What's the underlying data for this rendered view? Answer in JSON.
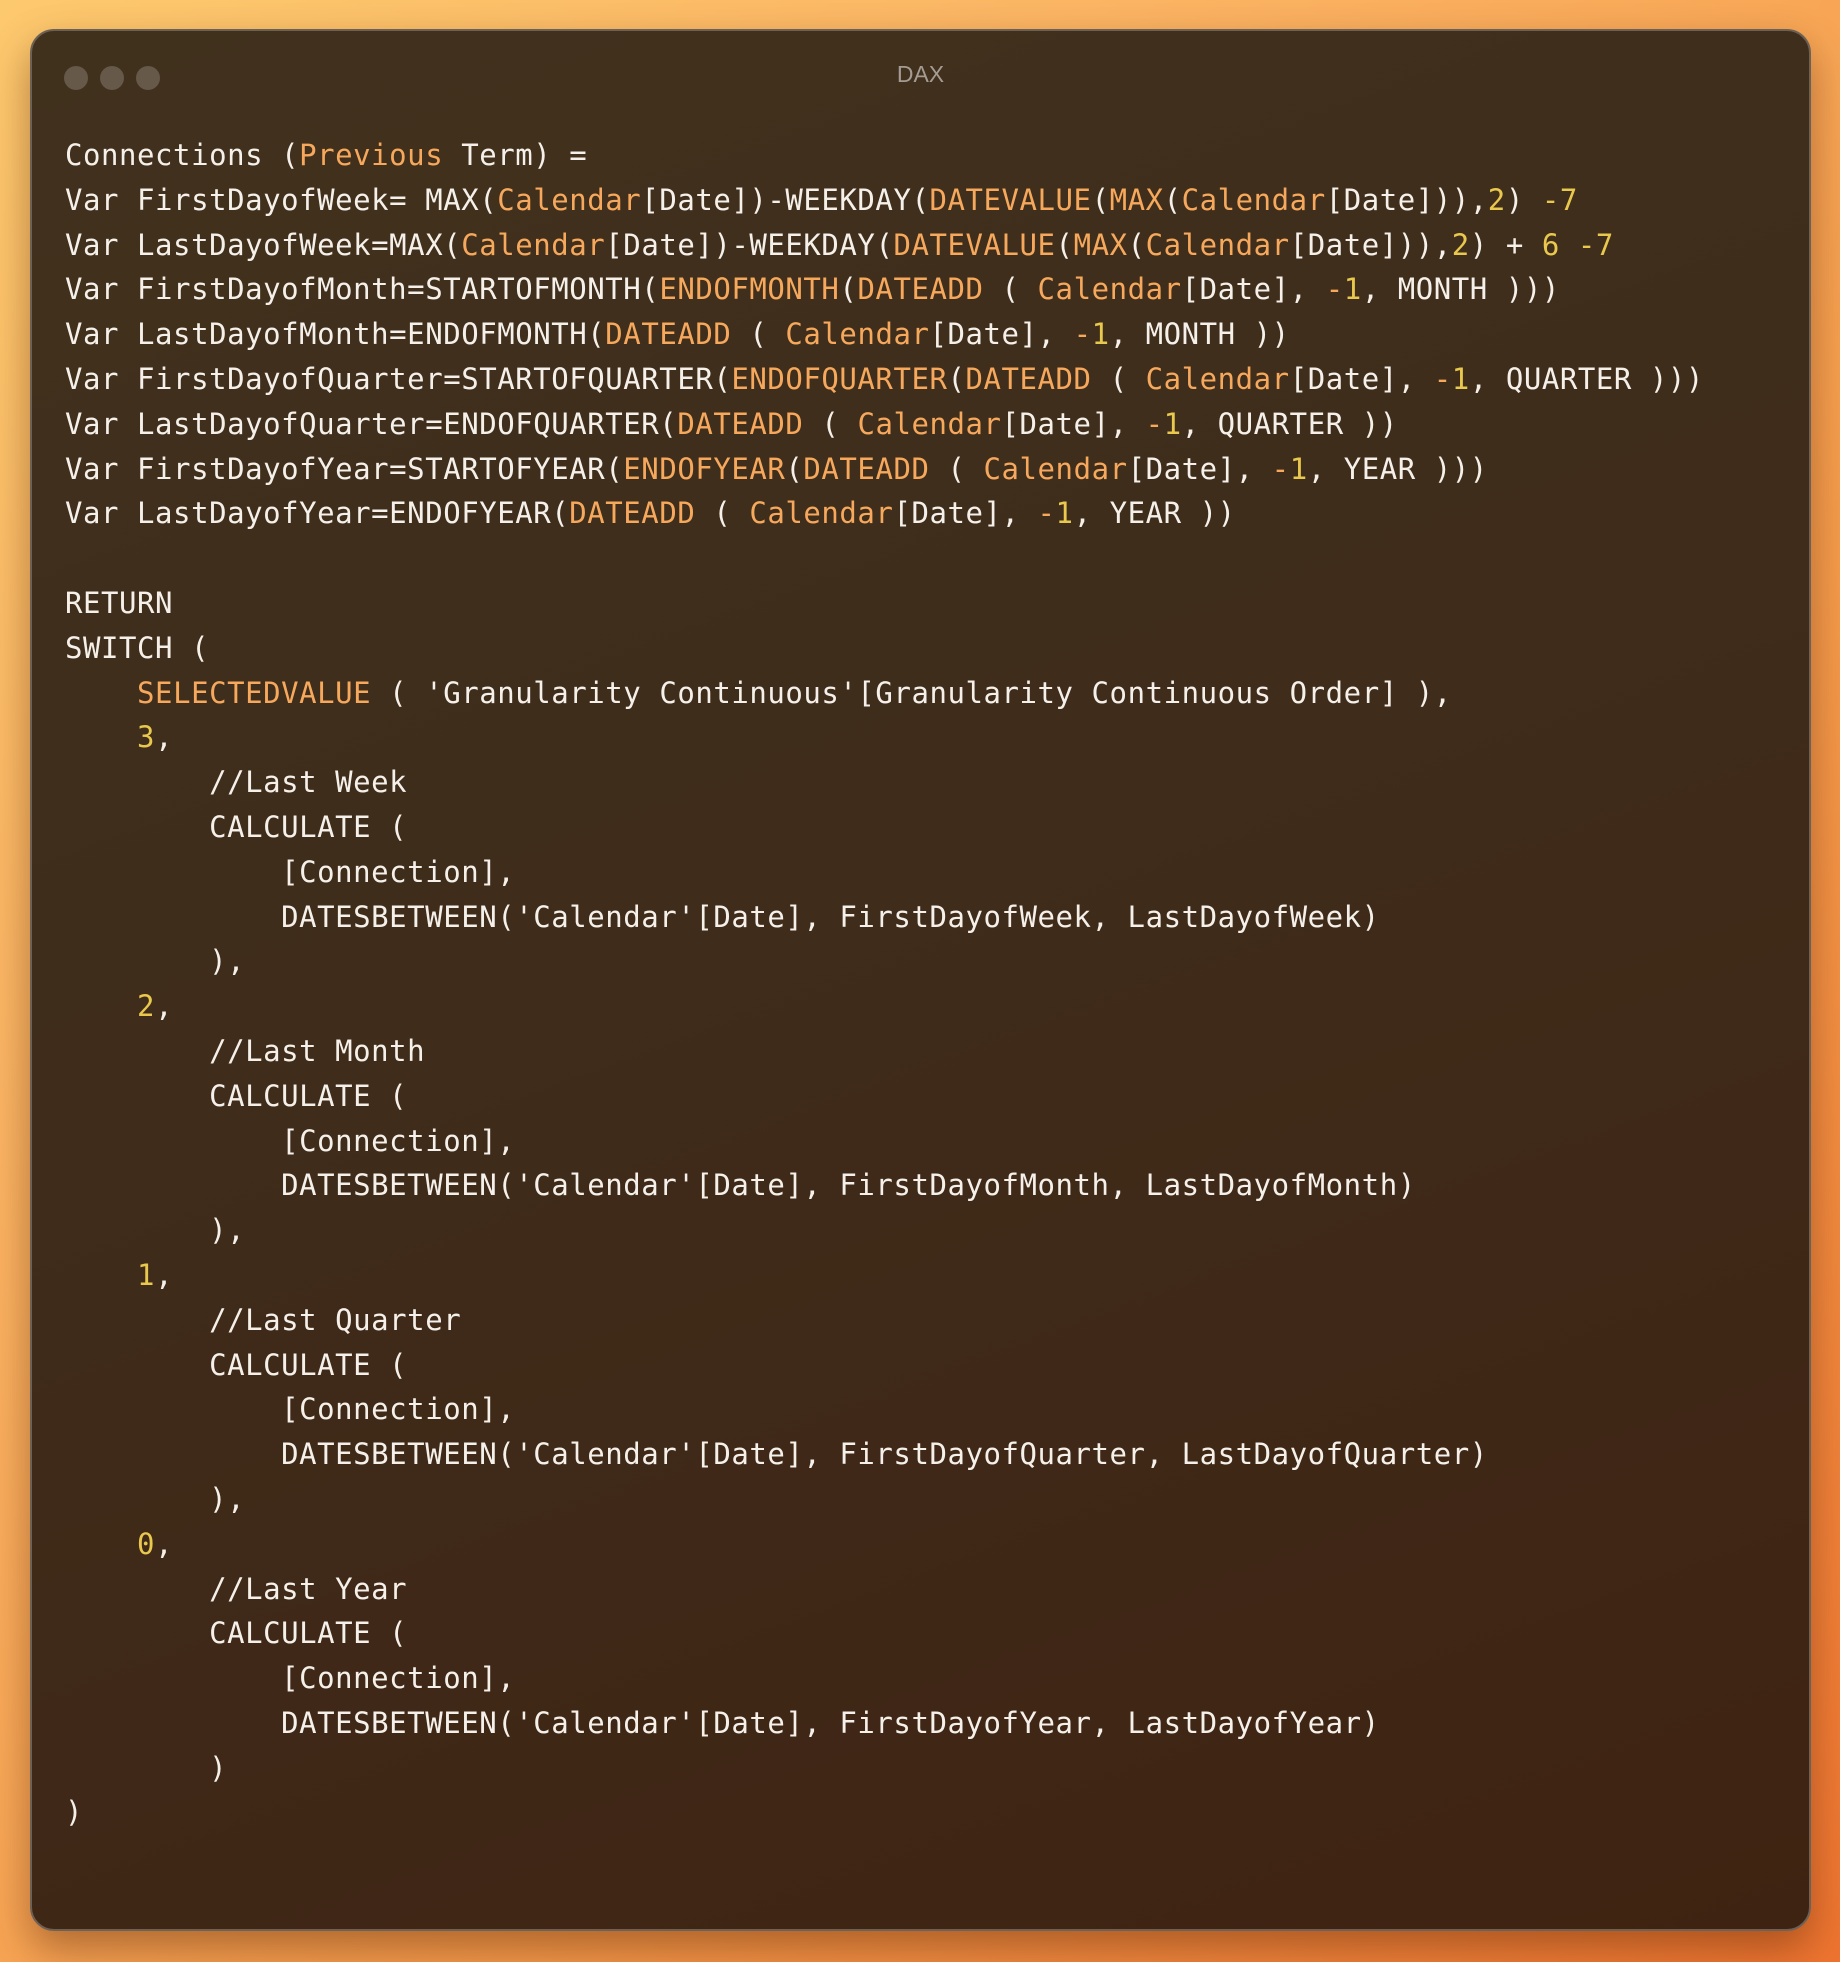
{
  "window": {
    "title": "DAX",
    "traffic_lights": [
      "close-dot",
      "minimize-dot",
      "zoom-dot"
    ]
  },
  "colors": {
    "plain": "#f5f1ea",
    "function": "#f6a85c",
    "number": "#e9c84e",
    "window_bg": "#40301c",
    "title": "#a49c93"
  },
  "code": {
    "language": "DAX",
    "lines": [
      [
        [
          "p",
          "Connections ("
        ],
        [
          "f",
          "Previous"
        ],
        [
          "p",
          " Term) ="
        ]
      ],
      [
        [
          "p",
          "Var FirstDayofWeek= MAX("
        ],
        [
          "f",
          "Calendar"
        ],
        [
          "p",
          "[Date])-WEEKDAY("
        ],
        [
          "f",
          "DATEVALUE"
        ],
        [
          "p",
          "("
        ],
        [
          "f",
          "MAX"
        ],
        [
          "p",
          "("
        ],
        [
          "f",
          "Calendar"
        ],
        [
          "p",
          "[Date])),"
        ],
        [
          "n",
          "2"
        ],
        [
          "p",
          ") "
        ],
        [
          "n",
          "-7"
        ]
      ],
      [
        [
          "p",
          "Var LastDayofWeek=MAX("
        ],
        [
          "f",
          "Calendar"
        ],
        [
          "p",
          "[Date])-WEEKDAY("
        ],
        [
          "f",
          "DATEVALUE"
        ],
        [
          "p",
          "("
        ],
        [
          "f",
          "MAX"
        ],
        [
          "p",
          "("
        ],
        [
          "f",
          "Calendar"
        ],
        [
          "p",
          "[Date])),"
        ],
        [
          "n",
          "2"
        ],
        [
          "p",
          ") + "
        ],
        [
          "n",
          "6"
        ],
        [
          "p",
          " "
        ],
        [
          "n",
          "-7"
        ]
      ],
      [
        [
          "p",
          "Var FirstDayofMonth=STARTOFMONTH("
        ],
        [
          "f",
          "ENDOFMONTH"
        ],
        [
          "p",
          "("
        ],
        [
          "f",
          "DATEADD"
        ],
        [
          "p",
          " ( "
        ],
        [
          "f",
          "Calendar"
        ],
        [
          "p",
          "[Date], "
        ],
        [
          "f",
          "-"
        ],
        [
          "n",
          "1"
        ],
        [
          "p",
          ", MONTH )))"
        ]
      ],
      [
        [
          "p",
          "Var LastDayofMonth=ENDOFMONTH("
        ],
        [
          "f",
          "DATEADD"
        ],
        [
          "p",
          " ( "
        ],
        [
          "f",
          "Calendar"
        ],
        [
          "p",
          "[Date], "
        ],
        [
          "f",
          "-"
        ],
        [
          "n",
          "1"
        ],
        [
          "p",
          ", MONTH ))"
        ]
      ],
      [
        [
          "p",
          "Var FirstDayofQuarter=STARTOFQUARTER("
        ],
        [
          "f",
          "ENDOFQUARTER"
        ],
        [
          "p",
          "("
        ],
        [
          "f",
          "DATEADD"
        ],
        [
          "p",
          " ( "
        ],
        [
          "f",
          "Calendar"
        ],
        [
          "p",
          "[Date], "
        ],
        [
          "f",
          "-"
        ],
        [
          "n",
          "1"
        ],
        [
          "p",
          ", QUARTER )))"
        ]
      ],
      [
        [
          "p",
          "Var LastDayofQuarter=ENDOFQUARTER("
        ],
        [
          "f",
          "DATEADD"
        ],
        [
          "p",
          " ( "
        ],
        [
          "f",
          "Calendar"
        ],
        [
          "p",
          "[Date], "
        ],
        [
          "f",
          "-"
        ],
        [
          "n",
          "1"
        ],
        [
          "p",
          ", QUARTER ))"
        ]
      ],
      [
        [
          "p",
          "Var FirstDayofYear=STARTOFYEAR("
        ],
        [
          "f",
          "ENDOFYEAR"
        ],
        [
          "p",
          "("
        ],
        [
          "f",
          "DATEADD"
        ],
        [
          "p",
          " ( "
        ],
        [
          "f",
          "Calendar"
        ],
        [
          "p",
          "[Date], "
        ],
        [
          "f",
          "-"
        ],
        [
          "n",
          "1"
        ],
        [
          "p",
          ", YEAR )))"
        ]
      ],
      [
        [
          "p",
          "Var LastDayofYear=ENDOFYEAR("
        ],
        [
          "f",
          "DATEADD"
        ],
        [
          "p",
          " ( "
        ],
        [
          "f",
          "Calendar"
        ],
        [
          "p",
          "[Date], "
        ],
        [
          "f",
          "-"
        ],
        [
          "n",
          "1"
        ],
        [
          "p",
          ", YEAR ))"
        ]
      ],
      [],
      [
        [
          "p",
          "RETURN"
        ]
      ],
      [
        [
          "p",
          "SWITCH ("
        ]
      ],
      [
        [
          "p",
          "    "
        ],
        [
          "f",
          "SELECTEDVALUE"
        ],
        [
          "p",
          " ( 'Granularity Continuous'[Granularity Continuous Order] ),"
        ]
      ],
      [
        [
          "p",
          "    "
        ],
        [
          "n",
          "3"
        ],
        [
          "p",
          ","
        ]
      ],
      [
        [
          "p",
          "        //Last Week"
        ]
      ],
      [
        [
          "p",
          "        CALCULATE ("
        ]
      ],
      [
        [
          "p",
          "            [Connection],"
        ]
      ],
      [
        [
          "p",
          "            DATESBETWEEN('Calendar'[Date], FirstDayofWeek, LastDayofWeek)"
        ]
      ],
      [
        [
          "p",
          "        ),"
        ]
      ],
      [
        [
          "p",
          "    "
        ],
        [
          "n",
          "2"
        ],
        [
          "p",
          ","
        ]
      ],
      [
        [
          "p",
          "        //Last Month"
        ]
      ],
      [
        [
          "p",
          "        CALCULATE ("
        ]
      ],
      [
        [
          "p",
          "            [Connection],"
        ]
      ],
      [
        [
          "p",
          "            DATESBETWEEN('Calendar'[Date], FirstDayofMonth, LastDayofMonth)"
        ]
      ],
      [
        [
          "p",
          "        ),"
        ]
      ],
      [
        [
          "p",
          "    "
        ],
        [
          "n",
          "1"
        ],
        [
          "p",
          ","
        ]
      ],
      [
        [
          "p",
          "        //Last Quarter"
        ]
      ],
      [
        [
          "p",
          "        CALCULATE ("
        ]
      ],
      [
        [
          "p",
          "            [Connection],"
        ]
      ],
      [
        [
          "p",
          "            DATESBETWEEN('Calendar'[Date], FirstDayofQuarter, LastDayofQuarter)"
        ]
      ],
      [
        [
          "p",
          "        ),"
        ]
      ],
      [
        [
          "p",
          "    "
        ],
        [
          "n",
          "0"
        ],
        [
          "p",
          ","
        ]
      ],
      [
        [
          "p",
          "        //Last Year"
        ]
      ],
      [
        [
          "p",
          "        CALCULATE ("
        ]
      ],
      [
        [
          "p",
          "            [Connection],"
        ]
      ],
      [
        [
          "p",
          "            DATESBETWEEN('Calendar'[Date], FirstDayofYear, LastDayofYear)"
        ]
      ],
      [
        [
          "p",
          "        )"
        ]
      ],
      [
        [
          "p",
          ")"
        ]
      ]
    ]
  }
}
